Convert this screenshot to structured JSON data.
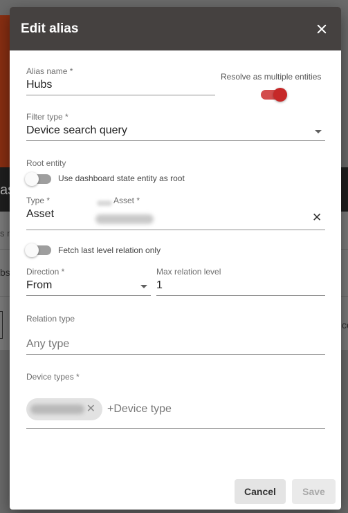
{
  "background": {
    "band_text": "as",
    "line1": "s n",
    "line2": "bs",
    "right_text": "ce"
  },
  "dialog": {
    "title": "Edit alias",
    "alias_name": {
      "label": "Alias name *",
      "value": "Hubs"
    },
    "resolve_multiple": {
      "label": "Resolve as multiple entities",
      "checked": true
    },
    "filter_type": {
      "label": "Filter type *",
      "value": "Device search query"
    },
    "root_entity": {
      "label": "Root entity",
      "toggle_label": "Use dashboard state entity as root",
      "checked": false
    },
    "type": {
      "label": "Type *",
      "value": "Asset"
    },
    "asset": {
      "label": "Asset *"
    },
    "fetch_last_level": {
      "label": "Fetch last level relation only",
      "checked": false
    },
    "direction": {
      "label": "Direction *",
      "value": "From"
    },
    "max_relation_level": {
      "label": "Max relation level",
      "value": "1"
    },
    "relation_type": {
      "label": "Relation type",
      "placeholder": "Any type"
    },
    "device_types": {
      "label": "Device types *",
      "add_placeholder": "+Device type"
    },
    "buttons": {
      "cancel": "Cancel",
      "save": "Save"
    }
  },
  "colors": {
    "header_bg": "#454140",
    "accent_red": "#c62828",
    "accent_track": "#d34d4d"
  }
}
